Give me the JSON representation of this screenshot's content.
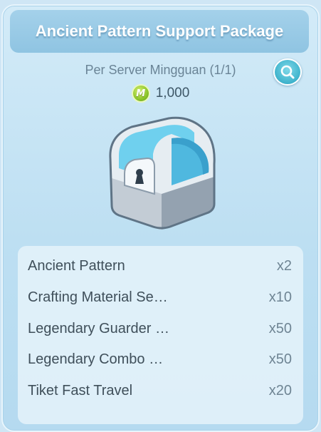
{
  "package": {
    "title": "Ancient Pattern Support Package",
    "purchase_limit": "Per Server Mingguan (1/1)",
    "currency_icon": "m-coin-icon",
    "currency_letter": "M",
    "price": "1,000",
    "preview_icon": "chest-icon"
  },
  "items": [
    {
      "name": "Ancient Pattern",
      "qty": "x2"
    },
    {
      "name": "Crafting Material Se…",
      "qty": "x10"
    },
    {
      "name": "Legendary Guarder …",
      "qty": "x50"
    },
    {
      "name": "Legendary Combo …",
      "qty": "x50"
    },
    {
      "name": "Tiket Fast Travel",
      "qty": "x20"
    }
  ],
  "colors": {
    "title_bar": "#8fc4e2",
    "accent": "#3fb3cc",
    "coin": "#8cc52a"
  }
}
